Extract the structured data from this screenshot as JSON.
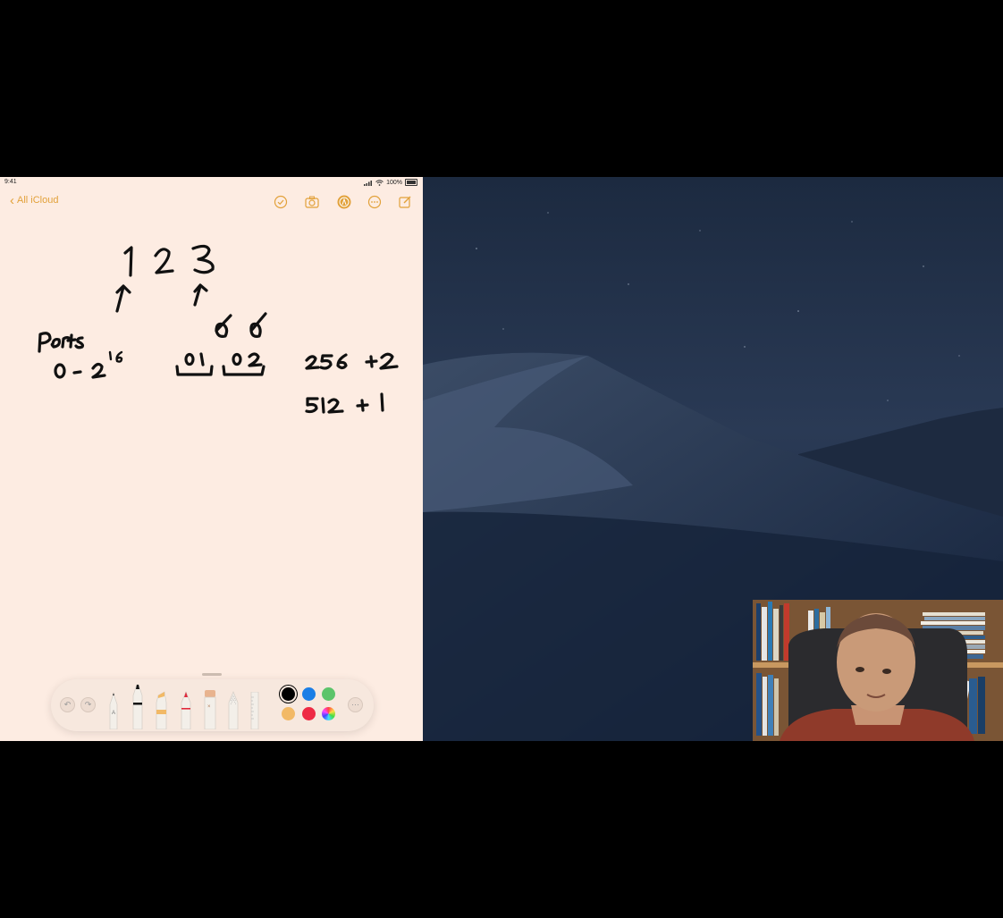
{
  "status_bar": {
    "time": "9:41",
    "battery": "100%"
  },
  "navigation": {
    "back_label": "All iCloud"
  },
  "nav_icons": [
    "checklist-icon",
    "camera-icon",
    "markup-icon",
    "more-icon",
    "compose-icon"
  ],
  "handwriting": {
    "numbers": [
      "1",
      "2",
      "3"
    ],
    "ports_label": "Ports",
    "ports_range": "0 - 2",
    "ports_exponent": "16",
    "bytes": [
      "01",
      "02"
    ],
    "calc_line1": "256 +2",
    "calc_line2": "512 +1"
  },
  "toolbar": {
    "tools": [
      "pen-tool",
      "marker-tool",
      "highlighter-tool",
      "pencil-tool",
      "eraser-tool",
      "lasso-tool",
      "ruler-tool"
    ],
    "colors": [
      "#000000",
      "#1a7ee6",
      "#5cc46a",
      "#f2b966",
      "#ee2a44",
      "color-wheel"
    ],
    "selected_color": "#000000"
  },
  "colors": {
    "accent": "#e2a13a",
    "note_background": "#fdece2"
  }
}
